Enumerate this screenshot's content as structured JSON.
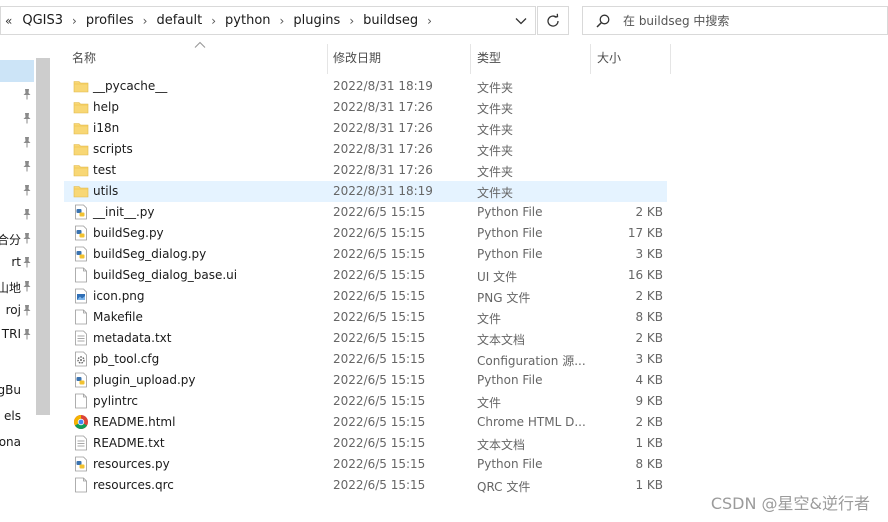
{
  "address_bar": {
    "overflow_glyph": "«",
    "crumbs": [
      "QGIS3",
      "profiles",
      "default",
      "python",
      "plugins",
      "buildseg"
    ],
    "separator": "›"
  },
  "search": {
    "placeholder": "在 buildseg 中搜索"
  },
  "nav": {
    "items": [
      {
        "label": ""
      },
      {
        "label": ""
      },
      {
        "label": ""
      },
      {
        "label": ""
      },
      {
        "label": ""
      },
      {
        "label": ""
      },
      {
        "label": ""
      },
      {
        "label": "合分"
      },
      {
        "label": "rt"
      },
      {
        "label": "_山地"
      },
      {
        "label": "roj"
      },
      {
        "label": "TRI"
      },
      {
        "label": ""
      },
      {
        "label": "tingBu"
      },
      {
        "label": "els"
      },
      {
        "label": "ersona"
      }
    ]
  },
  "columns": {
    "name": "名称",
    "date": "修改日期",
    "type": "类型",
    "size": "大小"
  },
  "files": [
    {
      "icon": "folder-icon",
      "name": "__pycache__",
      "date": "2022/8/31 18:19",
      "type": "文件夹",
      "size": ""
    },
    {
      "icon": "folder-icon",
      "name": "help",
      "date": "2022/8/31 17:26",
      "type": "文件夹",
      "size": ""
    },
    {
      "icon": "folder-icon",
      "name": "i18n",
      "date": "2022/8/31 17:26",
      "type": "文件夹",
      "size": ""
    },
    {
      "icon": "folder-icon",
      "name": "scripts",
      "date": "2022/8/31 17:26",
      "type": "文件夹",
      "size": ""
    },
    {
      "icon": "folder-icon",
      "name": "test",
      "date": "2022/8/31 17:26",
      "type": "文件夹",
      "size": ""
    },
    {
      "icon": "folder-icon",
      "name": "utils",
      "date": "2022/8/31 18:19",
      "type": "文件夹",
      "size": "",
      "selected": true
    },
    {
      "icon": "python-file-icon",
      "name": "__init__.py",
      "date": "2022/6/5 15:15",
      "type": "Python File",
      "size": "2 KB"
    },
    {
      "icon": "python-file-icon",
      "name": "buildSeg.py",
      "date": "2022/6/5 15:15",
      "type": "Python File",
      "size": "17 KB"
    },
    {
      "icon": "python-file-icon",
      "name": "buildSeg_dialog.py",
      "date": "2022/6/5 15:15",
      "type": "Python File",
      "size": "3 KB"
    },
    {
      "icon": "file-icon",
      "name": "buildSeg_dialog_base.ui",
      "date": "2022/6/5 15:15",
      "type": "UI 文件",
      "size": "16 KB"
    },
    {
      "icon": "image-file-icon",
      "name": "icon.png",
      "date": "2022/6/5 15:15",
      "type": "PNG 文件",
      "size": "2 KB"
    },
    {
      "icon": "file-icon",
      "name": "Makefile",
      "date": "2022/6/5 15:15",
      "type": "文件",
      "size": "8 KB"
    },
    {
      "icon": "text-file-icon",
      "name": "metadata.txt",
      "date": "2022/6/5 15:15",
      "type": "文本文档",
      "size": "2 KB"
    },
    {
      "icon": "config-file-icon",
      "name": "pb_tool.cfg",
      "date": "2022/6/5 15:15",
      "type": "Configuration 源...",
      "size": "3 KB"
    },
    {
      "icon": "python-file-icon",
      "name": "plugin_upload.py",
      "date": "2022/6/5 15:15",
      "type": "Python File",
      "size": "4 KB"
    },
    {
      "icon": "file-icon",
      "name": "pylintrc",
      "date": "2022/6/5 15:15",
      "type": "文件",
      "size": "9 KB"
    },
    {
      "icon": "chrome-html-icon",
      "name": "README.html",
      "date": "2022/6/5 15:15",
      "type": "Chrome HTML D...",
      "size": "2 KB"
    },
    {
      "icon": "text-file-icon",
      "name": "README.txt",
      "date": "2022/6/5 15:15",
      "type": "文本文档",
      "size": "1 KB"
    },
    {
      "icon": "python-file-icon",
      "name": "resources.py",
      "date": "2022/6/5 15:15",
      "type": "Python File",
      "size": "8 KB"
    },
    {
      "icon": "file-icon",
      "name": "resources.qrc",
      "date": "2022/6/5 15:15",
      "type": "QRC 文件",
      "size": "1 KB"
    }
  ],
  "watermark": "CSDN @星空&逆行者",
  "colors": {
    "selection": "#cce4f7",
    "row_highlight": "#e5f3ff",
    "folder": "#f8d775"
  }
}
